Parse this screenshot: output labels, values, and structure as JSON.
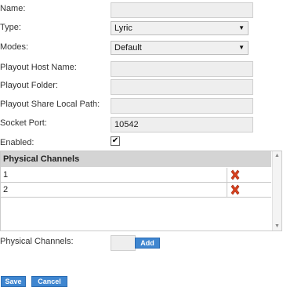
{
  "form": {
    "name_label": "Name:",
    "name_value": "",
    "type_label": "Type:",
    "type_value": "Lyric",
    "modes_label": "Modes:",
    "modes_value": "Default",
    "playout_host_label": "Playout Host Name:",
    "playout_host_value": "",
    "playout_folder_label": "Playout Folder:",
    "playout_folder_value": "",
    "share_path_label": "Playout Share Local Path:",
    "share_path_value": "",
    "socket_port_label": "Socket Port:",
    "socket_port_value": "10542",
    "enabled_label": "Enabled:",
    "enabled_checked": true
  },
  "channels_grid": {
    "header": "Physical Channels",
    "rows": [
      {
        "name": "1"
      },
      {
        "name": "2"
      }
    ]
  },
  "add_channel": {
    "label": "Physical Channels:",
    "value": "",
    "button_label": "Add"
  },
  "actions": {
    "save_label": "Save",
    "cancel_label": "Cancel"
  },
  "icons": {
    "delete": "red-x-icon",
    "dropdown": "chevron-down-icon"
  },
  "colors": {
    "button_bg": "#3f86d0",
    "grid_header_bg": "#d4d4d4",
    "delete_icon": "#d9411e"
  }
}
